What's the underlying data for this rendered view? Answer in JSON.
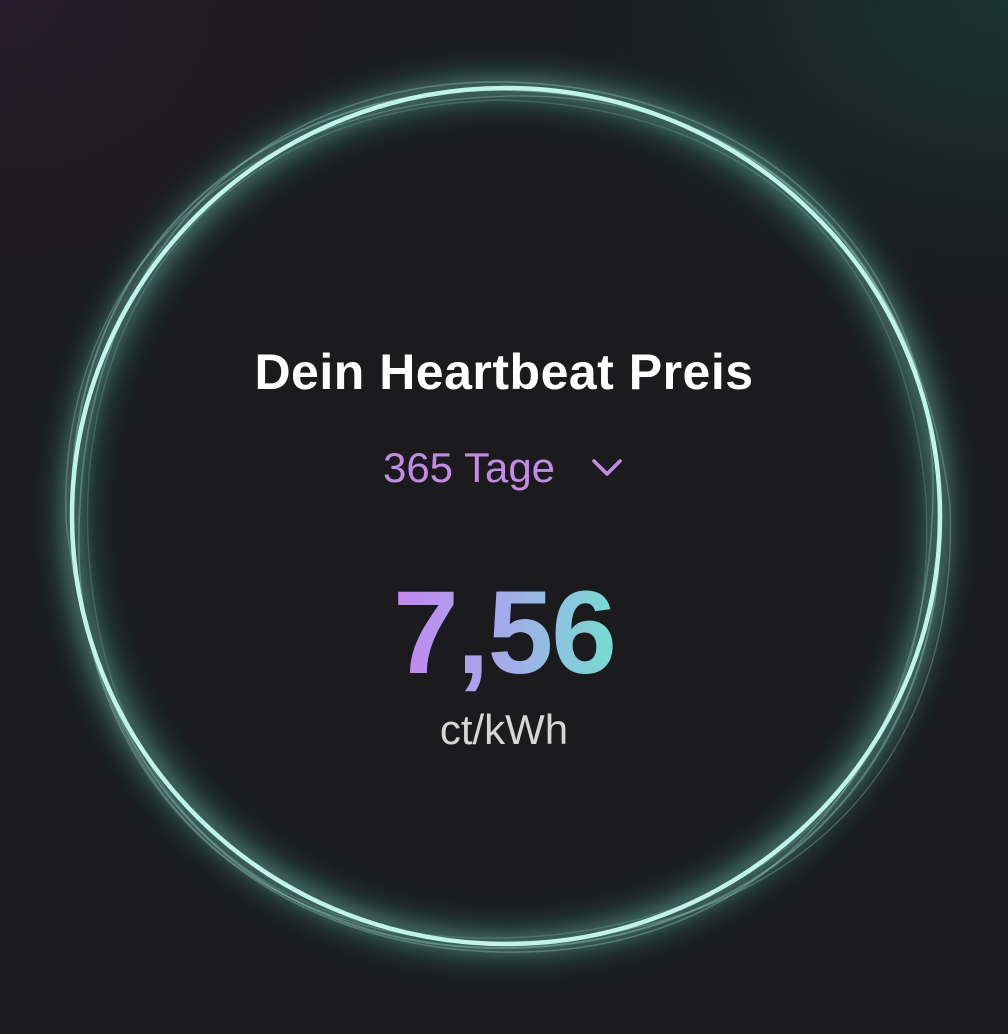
{
  "card": {
    "title": "Dein Heartbeat Preis",
    "period": {
      "selected": "365 Tage",
      "icon": "chevron-down-icon"
    },
    "price": {
      "value": "7,56",
      "unit": "ct/kWh"
    }
  },
  "colors": {
    "background": "#1b1b1d",
    "ring": "#9ee8d8",
    "ring_glow": "#3fd6b8",
    "period_text": "#c48ae8",
    "price_gradient_start": "#c586ef",
    "price_gradient_end": "#74ddd0",
    "unit_text": "#d6d6d6",
    "title_text": "#ffffff"
  }
}
